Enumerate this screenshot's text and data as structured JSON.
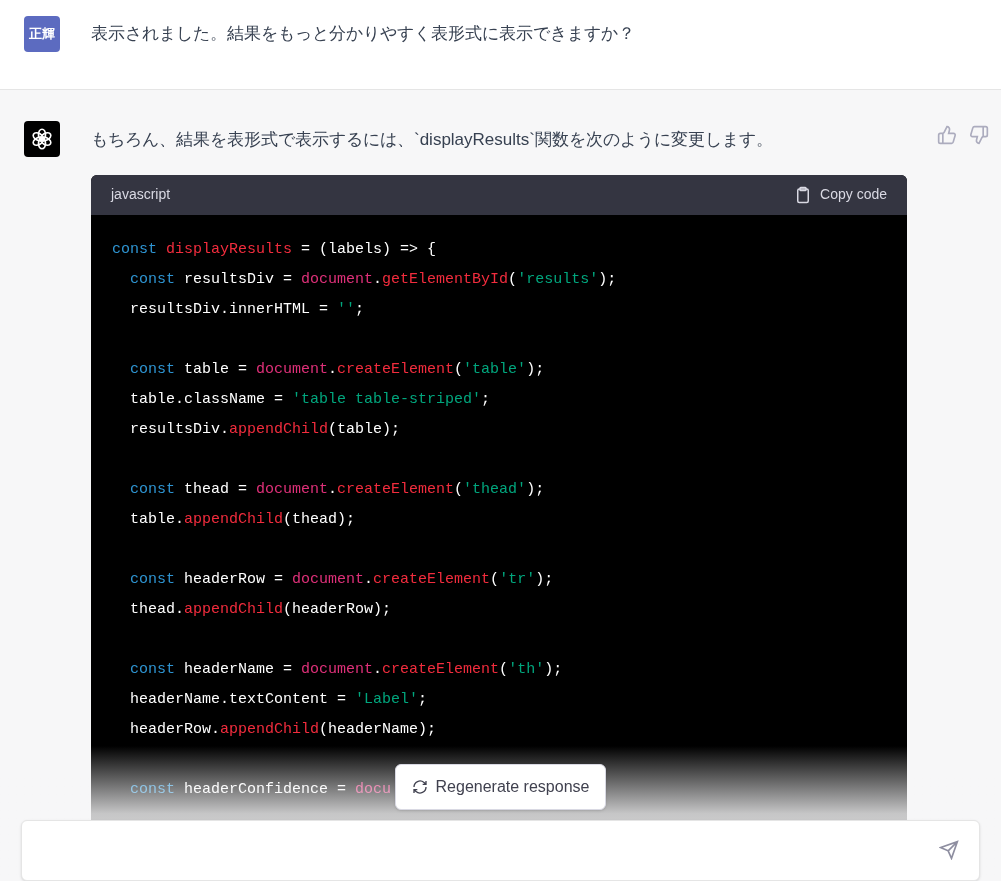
{
  "user_message": {
    "avatar": "正輝",
    "text": "表示されました。結果をもっと分かりやすく表形式に表示できますか？"
  },
  "assistant_message": {
    "text": "もちろん、結果を表形式で表示するには、`displayResults`関数を次のように変更します。",
    "code_block": {
      "language": "javascript",
      "copy_label": "Copy code",
      "lines": [
        {
          "kind": "code",
          "tokens": [
            {
              "kind": "keyword",
              "text": "const "
            },
            {
              "kind": "name",
              "text": "displayResults"
            },
            {
              "kind": "plain",
              "text": " = (labels) => {"
            }
          ]
        },
        {
          "kind": "code",
          "tokens": [
            {
              "kind": "keyword",
              "text": "  const "
            },
            {
              "kind": "plain",
              "text": "resultsDiv = "
            },
            {
              "kind": "object",
              "text": "document"
            },
            {
              "kind": "plain",
              "text": "."
            },
            {
              "kind": "name",
              "text": "getElementById"
            },
            {
              "kind": "plain",
              "text": "("
            },
            {
              "kind": "string",
              "text": "'results'"
            },
            {
              "kind": "plain",
              "text": ");"
            }
          ]
        },
        {
          "kind": "code",
          "tokens": [
            {
              "kind": "plain",
              "text": "  resultsDiv.innerHTML = "
            },
            {
              "kind": "string",
              "text": "''"
            },
            {
              "kind": "plain",
              "text": ";"
            }
          ]
        },
        {
          "kind": "blank"
        },
        {
          "kind": "code",
          "tokens": [
            {
              "kind": "keyword",
              "text": "  const "
            },
            {
              "kind": "plain",
              "text": "table = "
            },
            {
              "kind": "object",
              "text": "document"
            },
            {
              "kind": "plain",
              "text": "."
            },
            {
              "kind": "name",
              "text": "createElement"
            },
            {
              "kind": "plain",
              "text": "("
            },
            {
              "kind": "string",
              "text": "'table'"
            },
            {
              "kind": "plain",
              "text": ");"
            }
          ]
        },
        {
          "kind": "code",
          "tokens": [
            {
              "kind": "plain",
              "text": "  table.className = "
            },
            {
              "kind": "string",
              "text": "'table table-striped'"
            },
            {
              "kind": "plain",
              "text": ";"
            }
          ]
        },
        {
          "kind": "code",
          "tokens": [
            {
              "kind": "plain",
              "text": "  resultsDiv."
            },
            {
              "kind": "name",
              "text": "appendChild"
            },
            {
              "kind": "plain",
              "text": "(table);"
            }
          ]
        },
        {
          "kind": "blank"
        },
        {
          "kind": "code",
          "tokens": [
            {
              "kind": "keyword",
              "text": "  const "
            },
            {
              "kind": "plain",
              "text": "thead = "
            },
            {
              "kind": "object",
              "text": "document"
            },
            {
              "kind": "plain",
              "text": "."
            },
            {
              "kind": "name",
              "text": "createElement"
            },
            {
              "kind": "plain",
              "text": "("
            },
            {
              "kind": "string",
              "text": "'thead'"
            },
            {
              "kind": "plain",
              "text": ");"
            }
          ]
        },
        {
          "kind": "code",
          "tokens": [
            {
              "kind": "plain",
              "text": "  table."
            },
            {
              "kind": "name",
              "text": "appendChild"
            },
            {
              "kind": "plain",
              "text": "(thead);"
            }
          ]
        },
        {
          "kind": "blank"
        },
        {
          "kind": "code",
          "tokens": [
            {
              "kind": "keyword",
              "text": "  const "
            },
            {
              "kind": "plain",
              "text": "headerRow = "
            },
            {
              "kind": "object",
              "text": "document"
            },
            {
              "kind": "plain",
              "text": "."
            },
            {
              "kind": "name",
              "text": "createElement"
            },
            {
              "kind": "plain",
              "text": "("
            },
            {
              "kind": "string",
              "text": "'tr'"
            },
            {
              "kind": "plain",
              "text": ");"
            }
          ]
        },
        {
          "kind": "code",
          "tokens": [
            {
              "kind": "plain",
              "text": "  thead."
            },
            {
              "kind": "name",
              "text": "appendChild"
            },
            {
              "kind": "plain",
              "text": "(headerRow);"
            }
          ]
        },
        {
          "kind": "blank"
        },
        {
          "kind": "code",
          "tokens": [
            {
              "kind": "keyword",
              "text": "  const "
            },
            {
              "kind": "plain",
              "text": "headerName = "
            },
            {
              "kind": "object",
              "text": "document"
            },
            {
              "kind": "plain",
              "text": "."
            },
            {
              "kind": "name",
              "text": "createElement"
            },
            {
              "kind": "plain",
              "text": "("
            },
            {
              "kind": "string",
              "text": "'th'"
            },
            {
              "kind": "plain",
              "text": ");"
            }
          ]
        },
        {
          "kind": "code",
          "tokens": [
            {
              "kind": "plain",
              "text": "  headerName.textContent = "
            },
            {
              "kind": "string",
              "text": "'Label'"
            },
            {
              "kind": "plain",
              "text": ";"
            }
          ]
        },
        {
          "kind": "code",
          "tokens": [
            {
              "kind": "plain",
              "text": "  headerRow."
            },
            {
              "kind": "name",
              "text": "appendChild"
            },
            {
              "kind": "plain",
              "text": "(headerName);"
            }
          ]
        },
        {
          "kind": "blank"
        },
        {
          "kind": "code",
          "tokens": [
            {
              "kind": "keyword",
              "text": "  const "
            },
            {
              "kind": "plain",
              "text": "headerConfidence = "
            },
            {
              "kind": "object",
              "text": "docu"
            }
          ]
        }
      ]
    }
  },
  "regenerate_button": {
    "label": "Regenerate response"
  }
}
